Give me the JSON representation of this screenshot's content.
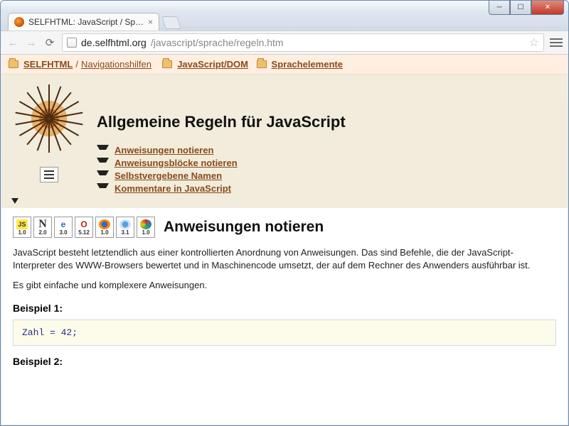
{
  "window": {
    "tab_title": "SELFHTML: JavaScript / Sp…",
    "url_host": "de.selfhtml.org",
    "url_path": "/javascript/sprache/regeln.htm"
  },
  "breadcrumb": {
    "root": "SELFHTML",
    "navhelp": "Navigationshilfen",
    "l2": "JavaScript/DOM",
    "l3": "Sprachelemente"
  },
  "page": {
    "title": "Allgemeine Regeln für JavaScript",
    "anchors": [
      "Anweisungen notieren",
      "Anweisungsblöcke notieren",
      "Selbstvergebene Namen",
      "Kommentare in JavaScript"
    ]
  },
  "badges": {
    "versions": [
      "1.0",
      "2.0",
      "3.0",
      "5.12",
      "1.0",
      "3.1",
      "1.0"
    ]
  },
  "section1": {
    "title": "Anweisungen notieren",
    "para1": "JavaScript besteht letztendlich aus einer kontrollierten Anordnung von Anweisungen. Das sind Befehle, die der JavaScript-Interpreter des WWW-Browsers bewertet und in Maschinencode umsetzt, der auf dem Rechner des Anwenders ausführbar ist.",
    "para2": "Es gibt einfache und komplexere Anweisungen.",
    "example1_label": "Beispiel 1:",
    "example1_code": "Zahl = 42;",
    "example2_label": "Beispiel 2:"
  }
}
